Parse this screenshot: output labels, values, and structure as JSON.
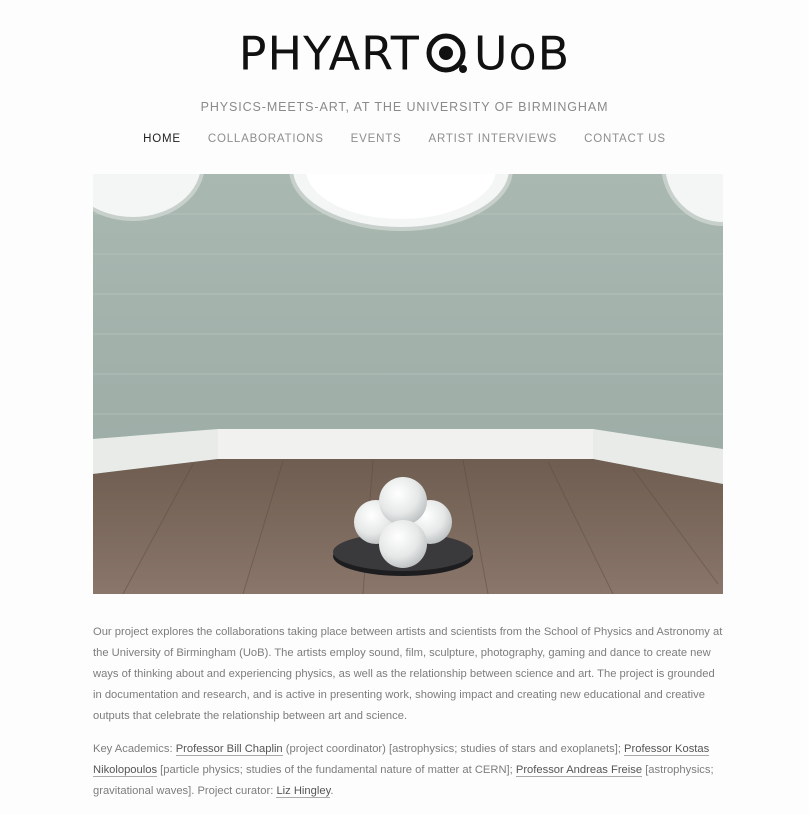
{
  "site": {
    "logo_left": "PHYART",
    "logo_right": "UoB",
    "tagline": "PHYSICS-MEETS-ART, AT THE UNIVERSITY OF BIRMINGHAM"
  },
  "nav": {
    "items": [
      {
        "label": "HOME",
        "active": true
      },
      {
        "label": "COLLABORATIONS",
        "active": false
      },
      {
        "label": "EVENTS",
        "active": false
      },
      {
        "label": "ARTIST INTERVIEWS",
        "active": false
      },
      {
        "label": "CONTACT US",
        "active": false
      }
    ]
  },
  "hero": {
    "description_icon": "sculpture-photo"
  },
  "content": {
    "intro": "Our project explores the collaborations taking place between artists and scientists from the School of Physics and Astronomy at the University of Birmingham (UoB). The artists employ sound, film, sculpture, photography, gaming and dance to create new ways of thinking about and experiencing physics, as well as the relationship between science and art. The project is grounded in documentation and research, and is active in presenting work, showing impact and creating new educational and creative outputs that celebrate the relationship between art and science.",
    "academics_prefix": "Key Academics: ",
    "link1": "Professor Bill Chaplin",
    "text1": " (project coordinator) [astrophysics; studies of stars and exoplanets]; ",
    "link2": "Professor Kostas Nikolopoulos",
    "text2": " [particle physics; studies of the fundamental nature of matter at CERN]; ",
    "link3": "Professor Andreas Freise",
    "text3": " [astrophysics; gravitational waves]. Project curator: ",
    "link4": "Liz Hingley",
    "text4": "."
  }
}
